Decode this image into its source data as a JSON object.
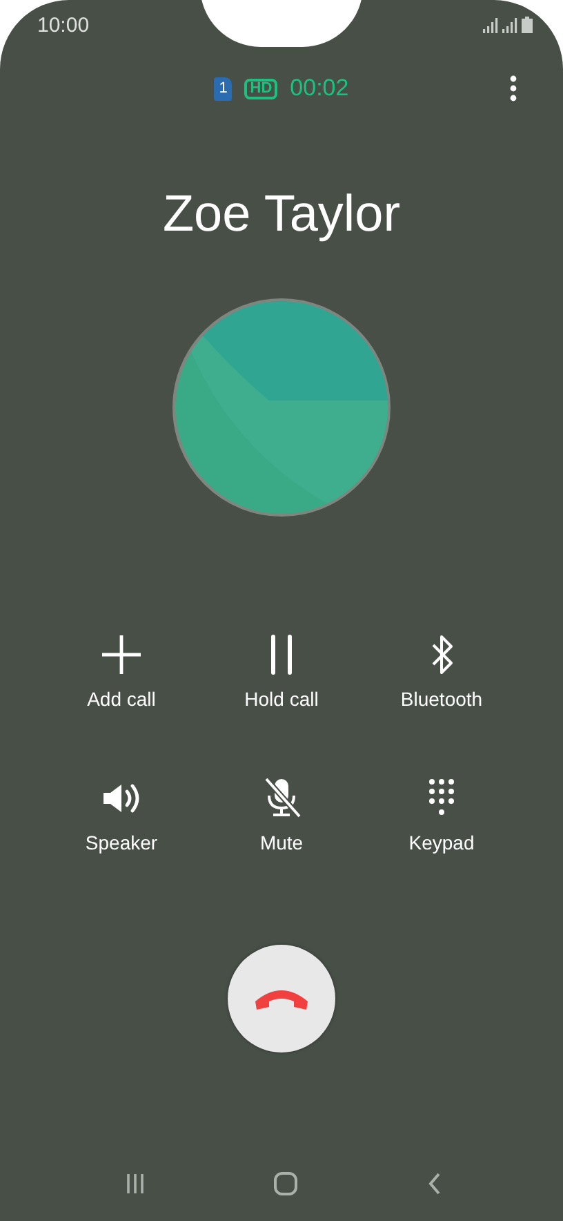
{
  "status_bar": {
    "time": "10:00"
  },
  "call_header": {
    "sim": "1",
    "hd": "HD",
    "duration": "00:02"
  },
  "contact": {
    "name": "Zoe Taylor"
  },
  "actions": [
    {
      "kind": "add",
      "label": "Add call"
    },
    {
      "kind": "hold",
      "label": "Hold call"
    },
    {
      "kind": "bluetooth",
      "label": "Bluetooth"
    },
    {
      "kind": "speaker",
      "label": "Speaker"
    },
    {
      "kind": "mute",
      "label": "Mute"
    },
    {
      "kind": "keypad",
      "label": "Keypad"
    }
  ]
}
